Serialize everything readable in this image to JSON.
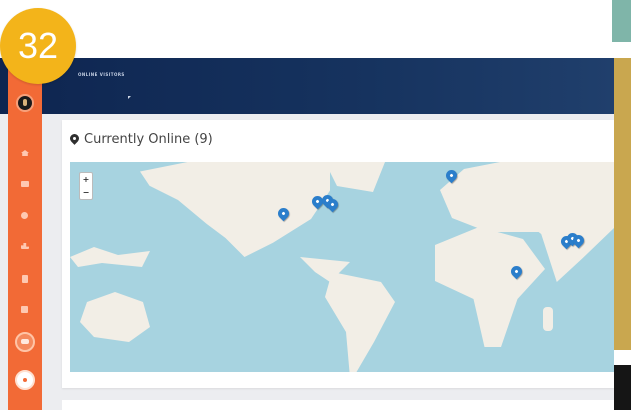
{
  "badge": {
    "number": "32"
  },
  "topbar": {
    "title": "ONLINE VISITORS"
  },
  "card": {
    "title": "Currently Online (9)"
  },
  "map": {
    "zoom_in": "+",
    "zoom_out": "−",
    "visitor_markers_count": 9
  },
  "sidebar": {
    "items": [
      "home-icon",
      "mail-icon",
      "users-icon",
      "chart-icon",
      "document-icon",
      "calendar-icon"
    ]
  },
  "colors": {
    "sidebar": "#f26a36",
    "topbar": "#16335f",
    "badge": "#f3b41a",
    "marker": "#2b7ecb",
    "water": "#a7d3e0",
    "land": "#f2eee6"
  }
}
